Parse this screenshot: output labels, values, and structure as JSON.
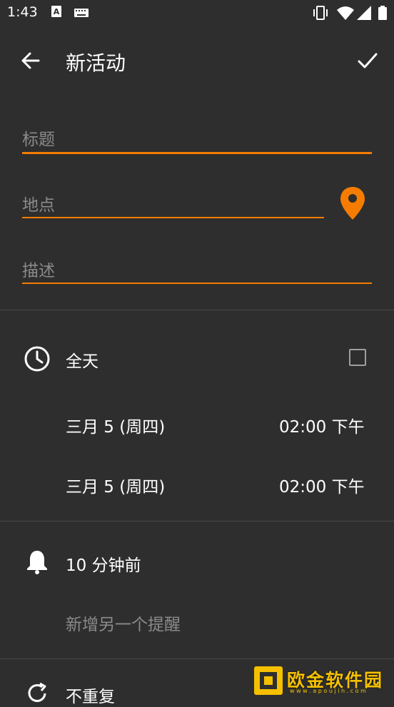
{
  "status_bar": {
    "time": "1:43",
    "icons": [
      "a-text-icon",
      "keyboard-icon",
      "vibrate-icon",
      "wifi-icon",
      "signal-icon",
      "battery-icon"
    ]
  },
  "app_bar": {
    "title": "新活动",
    "back_icon": "arrow-back-icon",
    "confirm_icon": "check-icon"
  },
  "form": {
    "title_placeholder": "标题",
    "location_placeholder": "地点",
    "description_placeholder": "描述",
    "location_icon": "map-pin-icon"
  },
  "time_section": {
    "all_day_label": "全天",
    "all_day_checked": false,
    "start_date": "三月 5 (周四)",
    "start_time": "02:00 下午",
    "end_date": "三月 5 (周四)",
    "end_time": "02:00 下午"
  },
  "reminder_section": {
    "reminder": "10 分钟前",
    "add_reminder": "新增另一个提醒"
  },
  "repeat_section": {
    "repeat": "不重复"
  },
  "watermark": {
    "text": "欧金软件园",
    "url": "w w w . a p o u j i n . c o m"
  },
  "colors": {
    "accent": "#f57c00",
    "background": "#2e2e2e",
    "muted_text": "#8a8a8a"
  }
}
